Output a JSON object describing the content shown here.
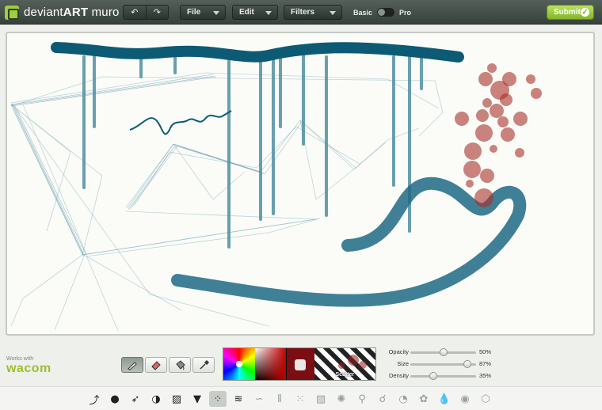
{
  "app": {
    "logo_prefix": "deviant",
    "logo_bold": "ART",
    "logo_suffix": " muro"
  },
  "toolbar": {
    "undo_icon": "undo-icon",
    "redo_icon": "redo-icon",
    "menus": [
      {
        "label": "File"
      },
      {
        "label": "Edit"
      },
      {
        "label": "Filters"
      }
    ],
    "mode_basic": "Basic",
    "mode_pro": "Pro",
    "submit_label": "Submit"
  },
  "footer": {
    "works_with": "Works with",
    "brand": "wacom"
  },
  "tools": [
    {
      "name": "brush-tool",
      "icon": "brush-icon",
      "active": true
    },
    {
      "name": "eraser-tool",
      "icon": "eraser-icon",
      "active": false
    },
    {
      "name": "fill-tool",
      "icon": "fill-bucket-icon",
      "active": false
    },
    {
      "name": "eyedropper-tool",
      "icon": "eyedropper-icon",
      "active": false
    }
  ],
  "colors": {
    "primary": "#7a0e12",
    "stroke_teal": "#0f5b78",
    "splatter_red": "#a8302a"
  },
  "swatch": {
    "brush_label": "Scatter"
  },
  "sliders": [
    {
      "label": "Opacity",
      "value": 50,
      "text": "50%"
    },
    {
      "label": "Size",
      "value": 87,
      "text": "87%"
    },
    {
      "label": "Density",
      "value": 35,
      "text": "35%"
    }
  ],
  "brushes": [
    "pen-brush-icon",
    "dot-brush-icon",
    "airbrush-icon",
    "pie-brush-icon",
    "hatch-brush-icon",
    "ink-drip-brush-icon",
    "scatter-brush-icon",
    "spiral-brush-icon",
    "wave-brush-icon",
    "lines-brush-icon",
    "grid-dots-brush-icon",
    "diagonal-brush-icon",
    "splatter-brush-icon",
    "sparkle-brush-icon",
    "bubble-brush-icon",
    "fan-brush-icon",
    "leaf-brush-icon",
    "drop-brush-icon",
    "sphere-brush-icon",
    "cube-brush-icon"
  ],
  "active_brush": 6
}
